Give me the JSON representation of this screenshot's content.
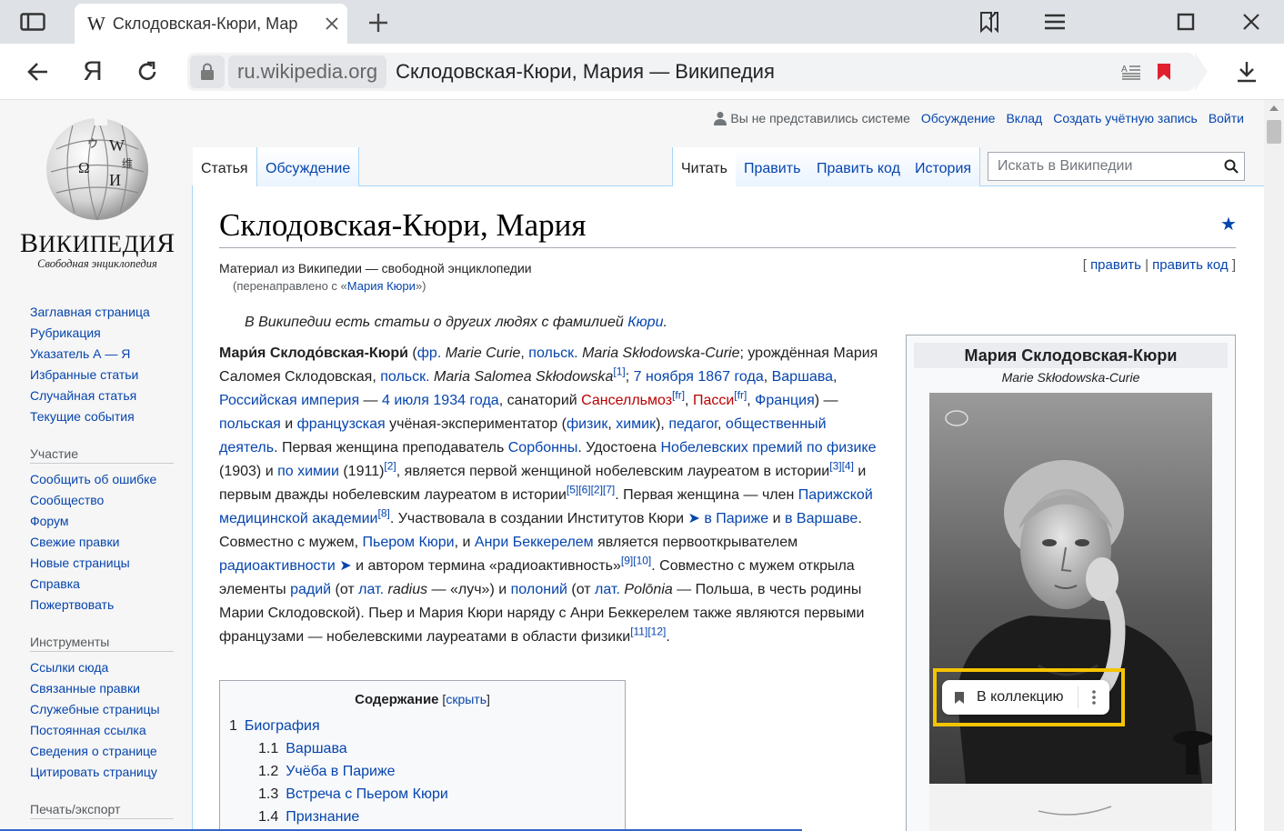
{
  "browser": {
    "tab_title": "Склодовская-Кюри, Мар",
    "tab_favicon": "W",
    "yandex_logo": "Я",
    "url_domain": "ru.wikipedia.org",
    "url_page_title": "Склодовская-Кюри, Мария — Википедия"
  },
  "logo": {
    "wordmark_big1": "В",
    "wordmark_mid": "ИКИПЕДИ",
    "wordmark_big2": "Я",
    "tagline": "Свободная энциклопедия"
  },
  "personal": {
    "anon": "Вы не представились системе",
    "talk": "Обсуждение",
    "contributions": "Вклад",
    "create": "Создать учётную запись",
    "login": "Войти"
  },
  "tabs": {
    "article": "Статья",
    "discussion": "Обсуждение",
    "read": "Читать",
    "edit": "Править",
    "edit_source": "Править код",
    "history": "История"
  },
  "search": {
    "placeholder": "Искать в Википедии"
  },
  "sidebar": {
    "nav": [
      "Заглавная страница",
      "Рубрикация",
      "Указатель А — Я",
      "Избранные статьи",
      "Случайная статья",
      "Текущие события"
    ],
    "participation_heading": "Участие",
    "participation": [
      "Сообщить об ошибке",
      "Сообщество",
      "Форум",
      "Свежие правки",
      "Новые страницы",
      "Справка",
      "Пожертвовать"
    ],
    "tools_heading": "Инструменты",
    "tools": [
      "Ссылки сюда",
      "Связанные правки",
      "Служебные страницы",
      "Постоянная ссылка",
      "Сведения о странице",
      "Цитировать страницу"
    ],
    "print_heading": "Печать/экспорт"
  },
  "article": {
    "title": "Склодовская-Кюри, Мария",
    "sitesub": "Материал из Википедии — свободной энциклопедии",
    "redirect_prefix": "(перенаправлено с «",
    "redirect_link": "Мария Кюри",
    "redirect_suffix": "»)",
    "edit_links": {
      "open": "[ ",
      "edit": "править",
      "sep": " | ",
      "edit_source": "править код",
      "close": " ]"
    },
    "hatnote_text": "В Википедии есть статьи о других людях с фамилией ",
    "hatnote_link": "Кюри",
    "hatnote_end": "."
  },
  "toc": {
    "title": "Содержание",
    "hide_open": " [",
    "hide": "скрыть",
    "hide_close": "]",
    "items": [
      {
        "num": "1",
        "text": "Биография",
        "level": 1
      },
      {
        "num": "1.1",
        "text": "Варшава",
        "level": 2
      },
      {
        "num": "1.2",
        "text": "Учёба в Париже",
        "level": 2
      },
      {
        "num": "1.3",
        "text": "Встреча с Пьером Кюри",
        "level": 2
      },
      {
        "num": "1.4",
        "text": "Признание",
        "level": 2
      }
    ]
  },
  "infobox": {
    "title": "Мария Склодовская-Кюри",
    "subtitle": "Marie Skłodowska-Curie"
  },
  "collection_button": {
    "label": "В коллекцию"
  },
  "icons": {
    "sidebar": "sidebar-toggle-icon",
    "close": "close-icon",
    "plus": "plus-icon",
    "bookmarks": "bookmarks-icon",
    "menu": "hamburger-menu-icon",
    "maximize": "maximize-icon",
    "window_close": "window-close-icon",
    "back": "arrow-left-icon",
    "reload": "reload-icon",
    "lock": "lock-icon",
    "reader": "reader-mode-icon",
    "bookmark": "bookmark-icon",
    "download": "download-icon",
    "user": "user-icon",
    "search": "search-icon",
    "star": "star-icon",
    "more": "more-vertical-icon"
  },
  "colors": {
    "link": "#0645ad",
    "redlink": "#ba0000",
    "highlight": "#f5c400",
    "bookmark_red": "#e0202e"
  }
}
